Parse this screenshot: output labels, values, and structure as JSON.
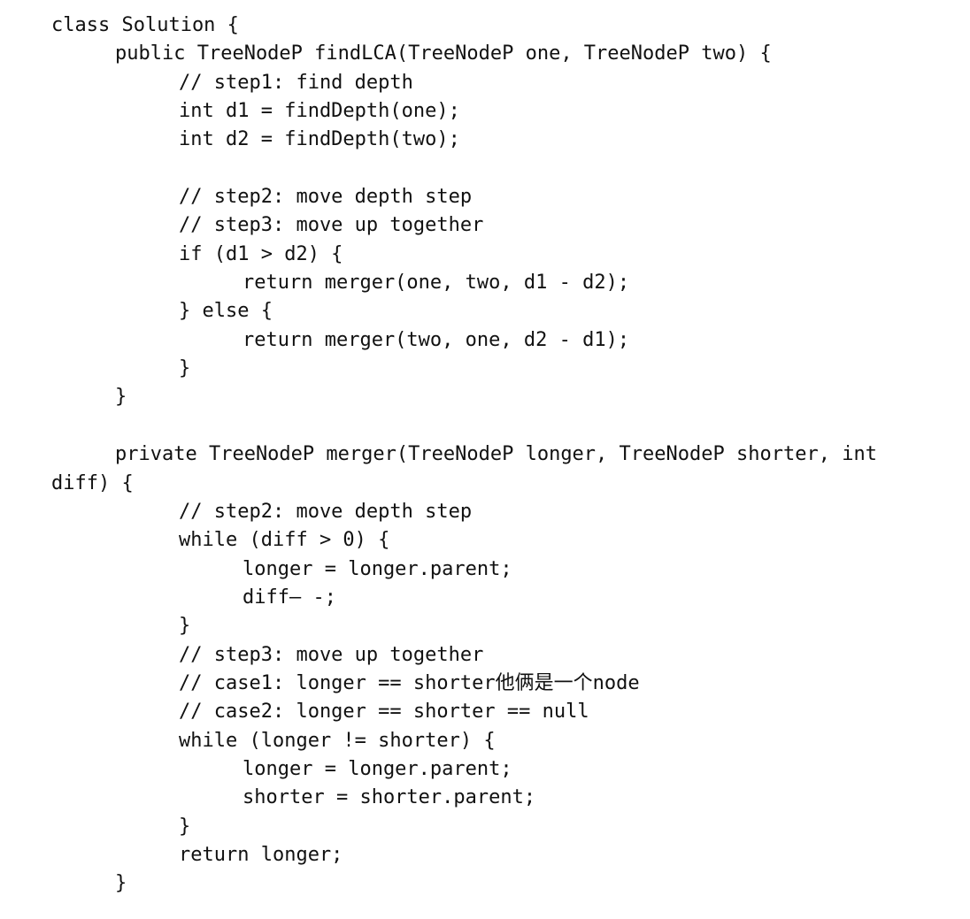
{
  "code_lines": [
    {
      "indent": 0,
      "text": "class Solution {"
    },
    {
      "indent": 1,
      "text": "public TreeNodeP findLCA(TreeNodeP one, TreeNodeP two) {"
    },
    {
      "indent": 2,
      "text": "// step1: find depth"
    },
    {
      "indent": 2,
      "text": "int d1 = findDepth(one);"
    },
    {
      "indent": 2,
      "text": "int d2 = findDepth(two);"
    },
    {
      "indent": 0,
      "text": ""
    },
    {
      "indent": 2,
      "text": "// step2: move depth step"
    },
    {
      "indent": 2,
      "text": "// step3: move up together"
    },
    {
      "indent": 2,
      "text": "if (d1 > d2) {"
    },
    {
      "indent": 3,
      "text": "return merger(one, two, d1 - d2);"
    },
    {
      "indent": 2,
      "text": "} else {"
    },
    {
      "indent": 3,
      "text": "return merger(two, one, d2 - d1);"
    },
    {
      "indent": 2,
      "text": "}"
    },
    {
      "indent": 1,
      "text": "}"
    },
    {
      "indent": 0,
      "text": ""
    },
    {
      "indent": 1,
      "text": "private TreeNodeP merger(TreeNodeP longer, TreeNodeP shorter, int"
    },
    {
      "indent": 0,
      "text": "diff) {"
    },
    {
      "indent": 2,
      "text": "// step2: move depth step"
    },
    {
      "indent": 2,
      "text": "while (diff > 0) {"
    },
    {
      "indent": 3,
      "text": "longer = longer.parent;"
    },
    {
      "indent": 3,
      "text": "diff– -;"
    },
    {
      "indent": 2,
      "text": "}"
    },
    {
      "indent": 2,
      "text": "// step3: move up together"
    },
    {
      "indent": 2,
      "text": "// case1: longer == shorter他俩是一个node"
    },
    {
      "indent": 2,
      "text": "// case2: longer == shorter == null"
    },
    {
      "indent": 2,
      "text": "while (longer != shorter) {"
    },
    {
      "indent": 3,
      "text": "longer = longer.parent;"
    },
    {
      "indent": 3,
      "text": "shorter = shorter.parent;"
    },
    {
      "indent": 2,
      "text": "}"
    },
    {
      "indent": 2,
      "text": "return longer;"
    },
    {
      "indent": 1,
      "text": "}"
    }
  ]
}
